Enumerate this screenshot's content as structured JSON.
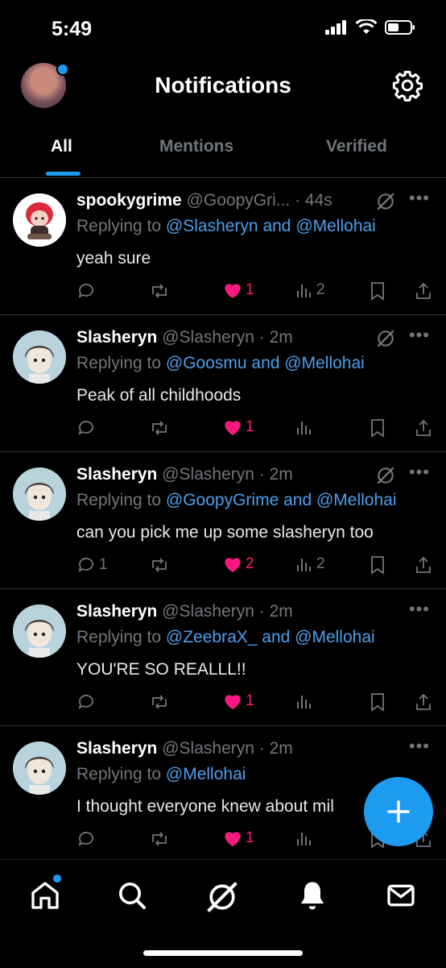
{
  "status": {
    "time": "5:49"
  },
  "header": {
    "title": "Notifications"
  },
  "tabs": [
    {
      "label": "All",
      "active": true
    },
    {
      "label": "Mentions",
      "active": false
    },
    {
      "label": "Verified",
      "active": false
    }
  ],
  "notifications": [
    {
      "name": "spookygrime",
      "handle": "@GoopyGri...",
      "time": "· 44s",
      "replying_prefix": "Replying to ",
      "replying_to": "@Slasheryn and @Mellohai",
      "text": "yeah sure",
      "replies": "",
      "likes": "1",
      "views": "2"
    },
    {
      "name": "Slasheryn",
      "handle": "@Slasheryn",
      "time": "· 2m",
      "replying_prefix": "Replying to ",
      "replying_to": "@Goosmu and @Mellohai",
      "text": "Peak of all childhoods",
      "replies": "",
      "likes": "1",
      "views": ""
    },
    {
      "name": "Slasheryn",
      "handle": "@Slasheryn",
      "time": "· 2m",
      "replying_prefix": "Replying to ",
      "replying_to": "@GoopyGrime and @Mellohai",
      "text": "can you pick me up some slasheryn too",
      "replies": "1",
      "likes": "2",
      "views": "2"
    },
    {
      "name": "Slasheryn",
      "handle": "@Slasheryn",
      "time": "· 2m",
      "replying_prefix": "Replying to ",
      "replying_to": "@ZeebraX_ and @Mellohai",
      "text": "YOU'RE SO REALLL!!",
      "replies": "",
      "likes": "1",
      "views": ""
    },
    {
      "name": "Slasheryn",
      "handle": "@Slasheryn",
      "time": "· 2m",
      "replying_prefix": "Replying to ",
      "replying_to": "@Mellohai",
      "text": "I thought everyone knew about mil",
      "replies": "",
      "likes": "1",
      "views": ""
    }
  ],
  "colors": {
    "accent": "#1d9bf0",
    "like": "#f91880",
    "link": "#4c9fea",
    "muted": "#71767b"
  },
  "icons": [
    "grok-icon",
    "more-icon",
    "reply-icon",
    "retweet-icon",
    "heart-icon",
    "views-icon",
    "bookmark-icon",
    "share-icon",
    "home-icon",
    "search-icon",
    "bell-icon",
    "mail-icon",
    "gear-icon"
  ]
}
